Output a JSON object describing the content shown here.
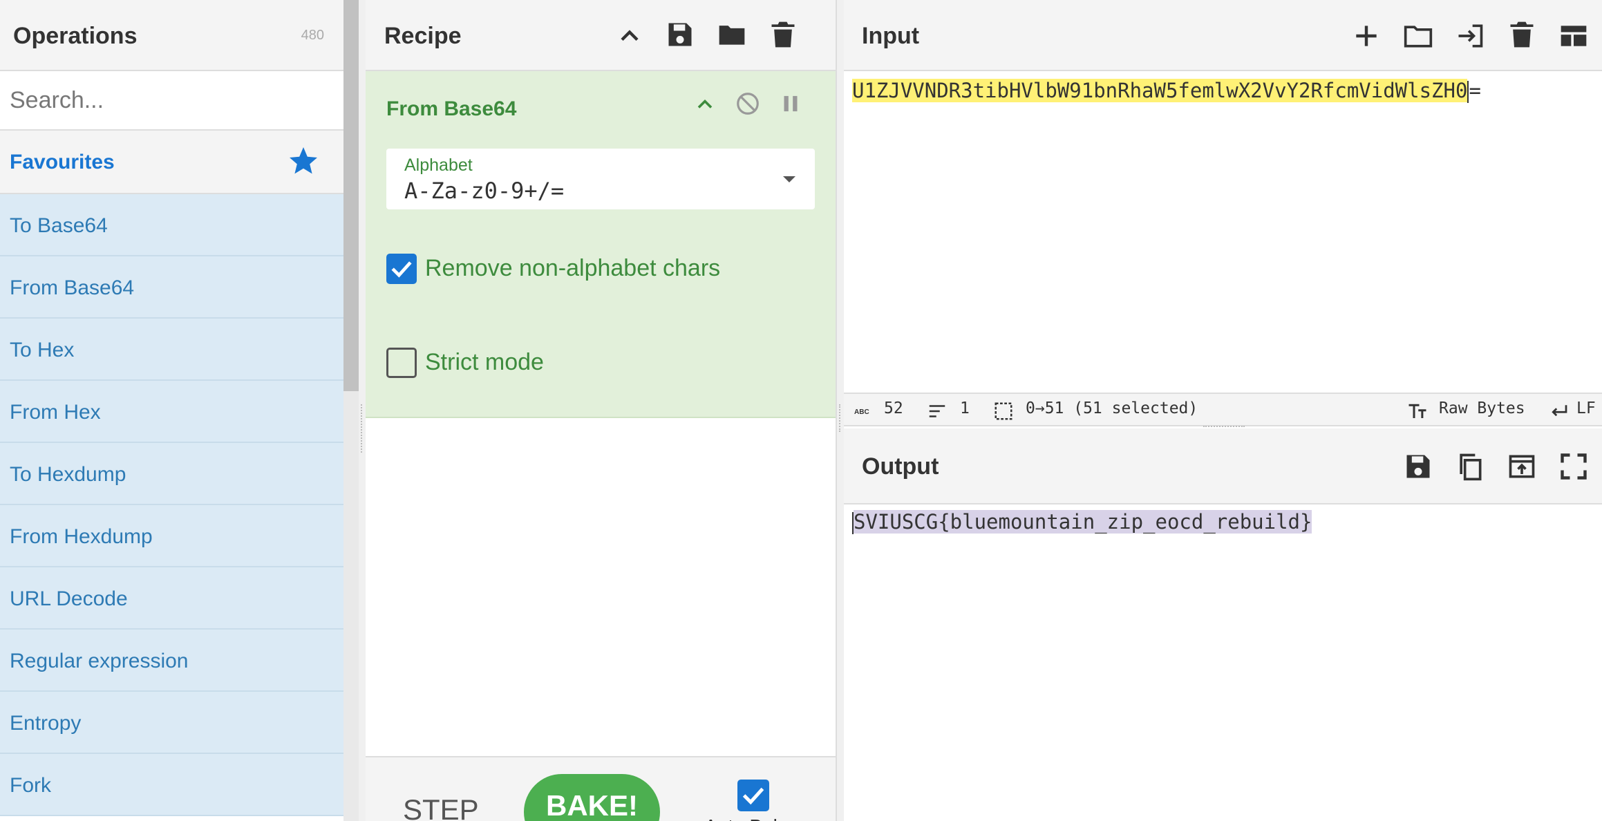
{
  "operations": {
    "title": "Operations",
    "count": "480",
    "search_placeholder": "Search...",
    "favourites_label": "Favourites",
    "items": [
      {
        "label": "To Base64"
      },
      {
        "label": "From Base64"
      },
      {
        "label": "To Hex"
      },
      {
        "label": "From Hex"
      },
      {
        "label": "To Hexdump"
      },
      {
        "label": "From Hexdump"
      },
      {
        "label": "URL Decode"
      },
      {
        "label": "Regular expression"
      },
      {
        "label": "Entropy"
      },
      {
        "label": "Fork"
      }
    ]
  },
  "recipe": {
    "title": "Recipe",
    "operation": {
      "name": "From Base64",
      "alphabet_label": "Alphabet",
      "alphabet_value": "A-Za-z0-9+/=",
      "remove_nonalpha_label": "Remove non-alphabet chars",
      "remove_nonalpha_checked": true,
      "strict_mode_label": "Strict mode",
      "strict_mode_checked": false
    },
    "step_label": "STEP",
    "bake_label": "BAKE!",
    "auto_bake_label": "Auto Bake",
    "auto_bake_checked": true
  },
  "input": {
    "title": "Input",
    "selected_text": "U1ZJVVNDR3tibHVlbW91bnRhaW5femlwX2VvY2RfcmVidWlsZH0",
    "unselected_text": "=",
    "status": {
      "length": "52",
      "lines": "1",
      "selection": "0→51 (51 selected)",
      "encoding": "Raw Bytes",
      "eol": "LF"
    }
  },
  "output": {
    "title": "Output",
    "selected_text": "SVIUSCG{bluemountain_zip_eocd_rebuild}"
  },
  "colors": {
    "accent": "#1976d2",
    "recipe_green": "#3d8b3d",
    "recipe_bg": "#e2f0da",
    "operation_bg": "#dbeaf5",
    "input_highlight": "#fff176",
    "output_highlight": "#d8d2e8",
    "bake_button": "#4caf50"
  },
  "icons": {
    "favourites": "star-icon",
    "recipe_toolbar": [
      "chevron-up-icon",
      "save-icon",
      "folder-icon",
      "trash-icon"
    ],
    "operation_controls": [
      "chevron-up-icon",
      "disable-icon",
      "pause-icon"
    ],
    "input_toolbar": [
      "plus-icon",
      "folder-icon",
      "import-icon",
      "trash-icon",
      "layout-icon"
    ],
    "output_toolbar": [
      "save-icon",
      "copy-icon",
      "replace-input-icon",
      "maximize-icon"
    ],
    "status": [
      "abc-icon",
      "lines-icon",
      "selection-icon",
      "text-size-icon",
      "return-icon"
    ]
  }
}
